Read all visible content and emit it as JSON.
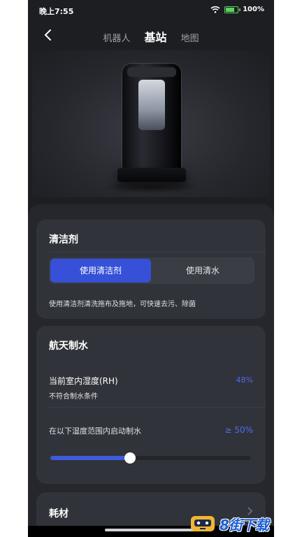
{
  "status_bar": {
    "time": "晚上7:55",
    "battery": "100%"
  },
  "nav": {
    "tabs": [
      {
        "label": "机器人",
        "active": false
      },
      {
        "label": "基站",
        "active": true
      },
      {
        "label": "地图",
        "active": false
      }
    ]
  },
  "cleaner_card": {
    "title": "清洁剂",
    "options": [
      "使用清洁剂",
      "使用清水"
    ],
    "selected": "使用清洁剂",
    "description": "使用清洁剂清洗拖布及拖地，可快速去污、除菌"
  },
  "water_card": {
    "title": "航天制水",
    "humidity_label": "当前室内湿度(RH)",
    "humidity_value": "48%",
    "humidity_note": "不符合制水条件",
    "threshold_label": "在以下湿度范围内启动制水",
    "threshold_value": "≥ 50%",
    "slider_fraction": 0.4
  },
  "supplies_card": {
    "title": "耗材"
  },
  "watermark": {
    "text": "8街下载"
  },
  "colors": {
    "accent": "#3650d8",
    "value_text": "#4d6cf0",
    "background": "#1d1e22",
    "card": "#31333a"
  }
}
